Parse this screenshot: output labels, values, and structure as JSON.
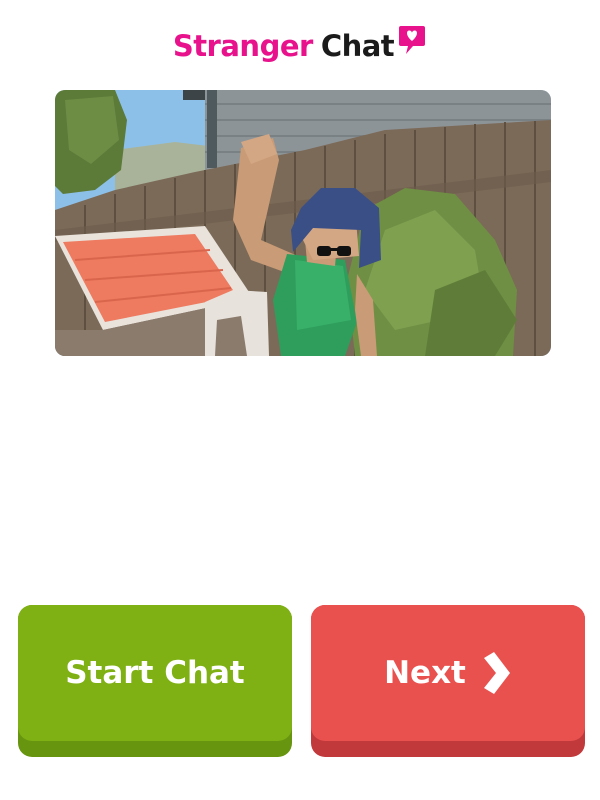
{
  "app": {
    "logo_word_1": "Stranger",
    "logo_word_2": "Chat"
  },
  "colors": {
    "brand_pink": "#e8128c",
    "start_green": "#7fb014",
    "next_red": "#e9514f"
  },
  "buttons": {
    "start_label": "Start Chat",
    "next_label": "Next",
    "next_icon": "chevron-right-icon"
  }
}
